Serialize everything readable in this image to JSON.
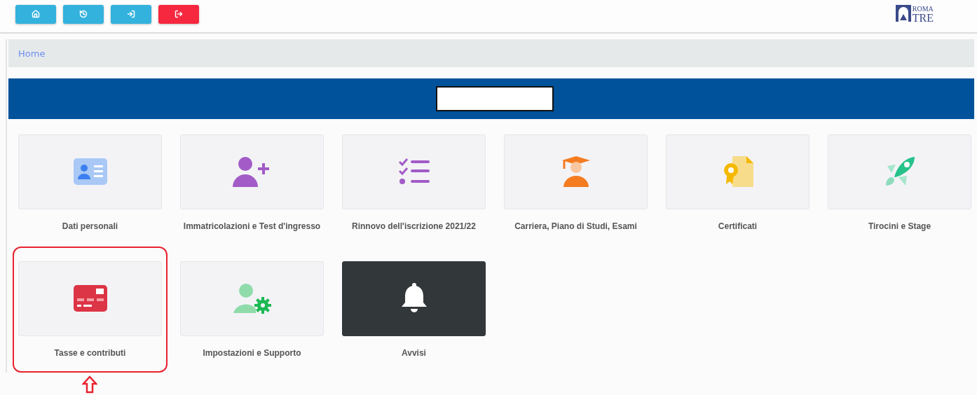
{
  "toolbar": {
    "buttons": [
      {
        "kind": "primary"
      },
      {
        "kind": "primary"
      },
      {
        "kind": "primary"
      },
      {
        "kind": "danger"
      }
    ]
  },
  "logo": {
    "line_1": "ROMA",
    "line_2": "TRE"
  },
  "breadcrumb": {
    "items": [
      "Home"
    ]
  },
  "banner": {
    "redacted": true
  },
  "tiles": [
    {
      "label": "Dati personali",
      "kind": "light",
      "highlighted": false
    },
    {
      "label": "Immatricolazioni e Test d'ingresso",
      "kind": "light",
      "highlighted": false
    },
    {
      "label": "Rinnovo dell'iscrizione 2021/22",
      "kind": "light",
      "highlighted": false
    },
    {
      "label": "Carriera, Piano di Studi, Esami",
      "kind": "light",
      "highlighted": false
    },
    {
      "label": "Certificati",
      "kind": "light",
      "highlighted": false
    },
    {
      "label": "Tirocini e Stage",
      "kind": "light",
      "highlighted": false
    },
    {
      "label": "Tasse e contributi",
      "kind": "light",
      "highlighted": true
    },
    {
      "label": "Impostazioni e Supporto",
      "kind": "light",
      "highlighted": false
    },
    {
      "label": "Avvisi",
      "kind": "dark",
      "highlighted": false
    }
  ]
}
